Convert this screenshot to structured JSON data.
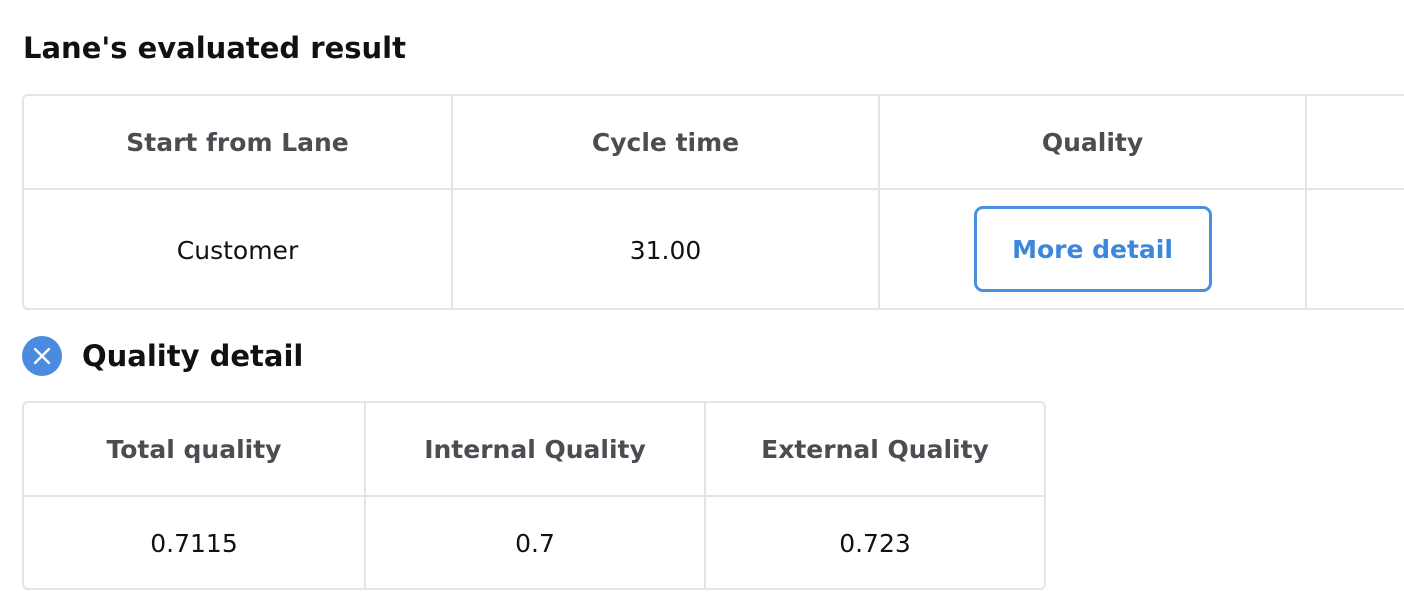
{
  "result": {
    "title": "Lane's evaluated result",
    "headers": {
      "start_from_lane": "Start from Lane",
      "cycle_time": "Cycle time",
      "quality": "Quality"
    },
    "row": {
      "start_from_lane": "Customer",
      "cycle_time": "31.00",
      "quality_button": "More detail"
    }
  },
  "quality_detail": {
    "title": "Quality detail",
    "close_icon": "close-icon",
    "headers": {
      "total": "Total quality",
      "internal": "Internal Quality",
      "external": "External Quality"
    },
    "row": {
      "total": "0.7115",
      "internal": "0.7",
      "external": "0.723"
    }
  },
  "colors": {
    "accent": "#4a90e2",
    "border": "#e2e4e8",
    "header_text": "#4a4d52"
  }
}
